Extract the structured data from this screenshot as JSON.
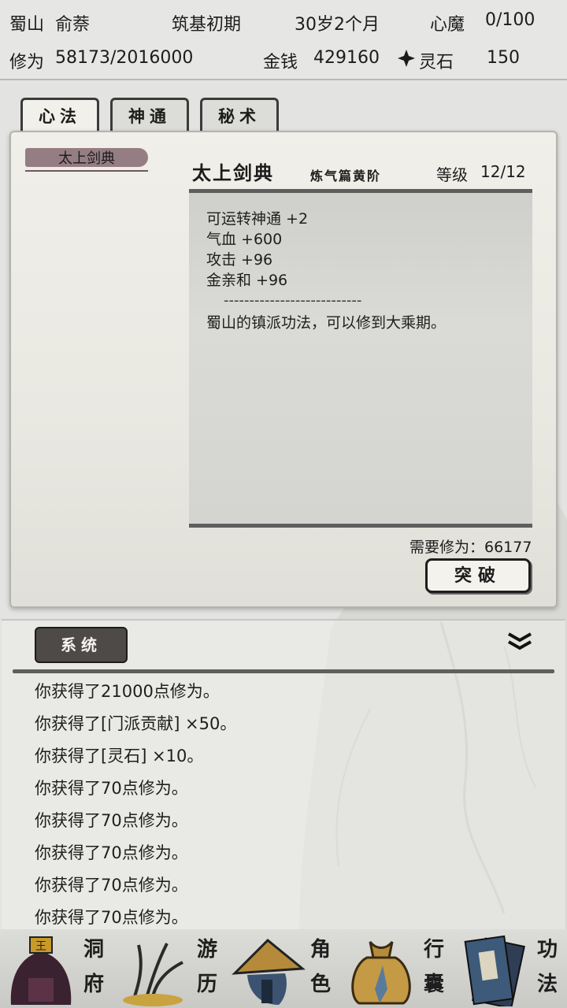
{
  "header": {
    "sect": "蜀山",
    "name": "俞萘",
    "realm": "筑基初期",
    "age": "30岁2个月",
    "demon_label": "心魔",
    "demon_value": "0/100",
    "cultivation_label": "修为",
    "cultivation_value": "58173/2016000",
    "money_label": "金钱",
    "money_value": "429160",
    "stone_label": "灵石",
    "stone_value": "150"
  },
  "tabs": [
    {
      "label": "心法",
      "active": true
    },
    {
      "label": "神通",
      "active": false
    },
    {
      "label": "秘术",
      "active": false
    }
  ],
  "skill": {
    "list_item": "太上剑典",
    "title": "太上剑典",
    "subtitle": "炼气篇黄阶",
    "level_label": "等级",
    "level_value": "12/12",
    "effects": [
      "可运转神通 +2",
      "气血 +600",
      "攻击 +96",
      "金亲和 +96"
    ],
    "divider": "---------------------------",
    "description": "蜀山的镇派功法，可以修到大乘期。",
    "cost_text": "需要修为：66177",
    "breakthrough_label": "突破"
  },
  "log": {
    "tab_label": "系统",
    "lines": [
      "你获得了21000点修为。",
      "你获得了[门派贡献] ×50。",
      "你获得了[灵石] ×10。",
      "你获得了70点修为。",
      "你获得了70点修为。",
      "你获得了70点修为。",
      "你获得了70点修为。",
      "你获得了70点修为。"
    ]
  },
  "nav": [
    {
      "label": [
        "洞",
        "府"
      ],
      "icon": "cave-dwelling-icon"
    },
    {
      "label": [
        "游",
        "历"
      ],
      "icon": "travel-hat-icon"
    },
    {
      "label": [
        "角",
        "色"
      ],
      "icon": "character-bag-icon"
    },
    {
      "label": [
        "行",
        "囊"
      ],
      "icon": "inventory-sack-icon"
    },
    {
      "label": [
        "功",
        "法"
      ],
      "icon": "technique-books-icon"
    }
  ]
}
